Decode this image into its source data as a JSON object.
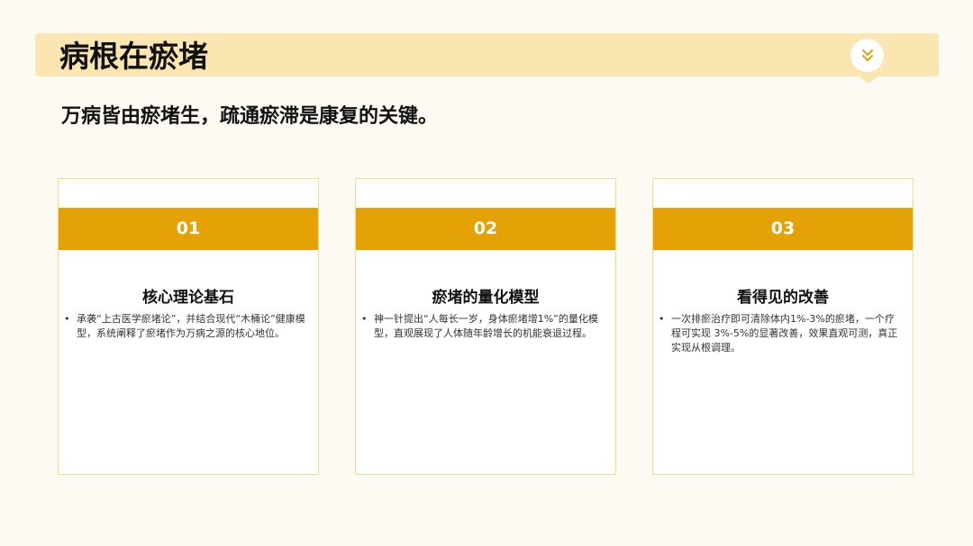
{
  "header": {
    "title": "病根在瘀堵",
    "badge_icon": "double-chevron-down-icon"
  },
  "subtitle": "万病皆由瘀堵生，疏通瘀滞是康复的关键。",
  "cards": [
    {
      "number": "01",
      "title": "核心理论基石",
      "bullet": "•",
      "text": "承袭“上古医学瘀堵论”，并结合现代“木桶论”健康模型，系统阐释了瘀堵作为万病之源的核心地位。"
    },
    {
      "number": "02",
      "title": "瘀堵的量化模型",
      "bullet": "•",
      "text": "神一针提出“人每长一岁，身体瘀堵增1%”的量化模型，直观展现了人体随年龄增长的机能衰退过程。"
    },
    {
      "number": "03",
      "title": "看得见的改善",
      "bullet": "•",
      "text": "一次排瘀治疗即可清除体内1%-3%的瘀堵，一个疗程可实现 3%-5%的显著改善，效果直观可测，真正实现从根调理。"
    }
  ],
  "colors": {
    "banner": "#fbe6b1",
    "accent": "#e5a207",
    "card_border": "#f1dc8a",
    "background": "#fdfaf3"
  }
}
